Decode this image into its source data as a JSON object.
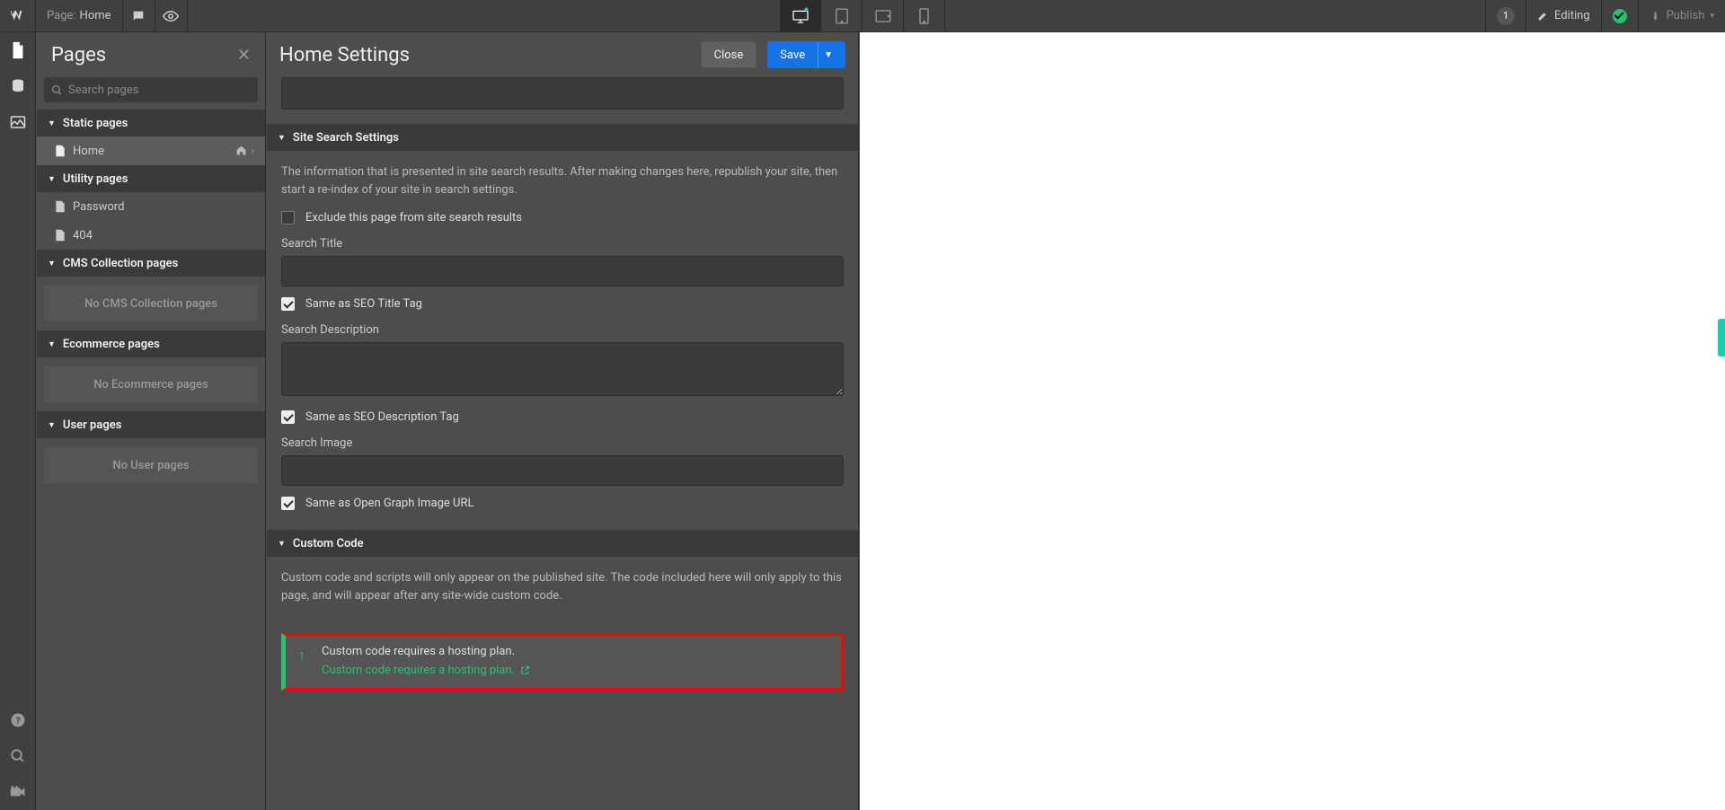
{
  "topbar": {
    "page_label": "Page:",
    "page_name": "Home",
    "notification_count": "1",
    "editing_label": "Editing",
    "publish_label": "Publish"
  },
  "sidebar": {
    "title": "Pages",
    "search_placeholder": "Search pages",
    "sections": {
      "static": {
        "title": "Static pages",
        "items": [
          "Home"
        ]
      },
      "utility": {
        "title": "Utility pages",
        "items": [
          "Password",
          "404"
        ]
      },
      "cms": {
        "title": "CMS Collection pages",
        "empty": "No CMS Collection pages"
      },
      "ecommerce": {
        "title": "Ecommerce pages",
        "empty": "No Ecommerce pages"
      },
      "user": {
        "title": "User pages",
        "empty": "No User pages"
      }
    }
  },
  "settings": {
    "title": "Home Settings",
    "close_label": "Close",
    "save_label": "Save",
    "site_search": {
      "header": "Site Search Settings",
      "desc": "The information that is presented in site search results. After making changes here, republish your site, then start a re-index of your site in search settings.",
      "exclude_label": "Exclude this page from site search results",
      "title_label": "Search Title",
      "title_same_label": "Same as SEO Title Tag",
      "desc_label": "Search Description",
      "desc_same_label": "Same as SEO Description Tag",
      "image_label": "Search Image",
      "image_same_label": "Same as Open Graph Image URL"
    },
    "custom_code": {
      "header": "Custom Code",
      "desc": "Custom code and scripts will only appear on the published site. The code included here will only apply to this page, and will appear after any site-wide custom code.",
      "notice_l1": "Custom code requires a hosting plan.",
      "notice_l2": "Custom code requires a hosting plan."
    }
  }
}
